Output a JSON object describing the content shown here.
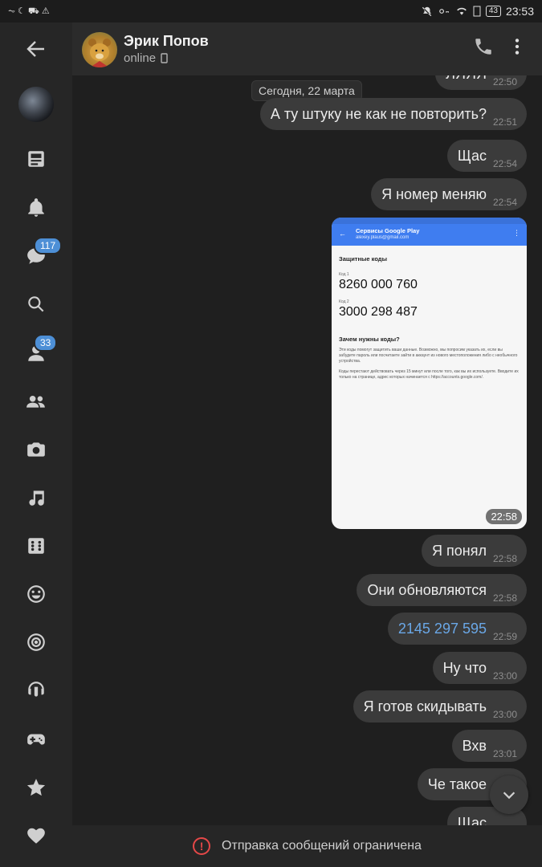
{
  "status_bar": {
    "time": "23:53",
    "battery": "43",
    "left_icons": "⏦ ☾ ⛟ ⚠"
  },
  "colors": {
    "accent": "#4d8fd6",
    "bubble": "#3b3b3b",
    "background": "#1f1f1f",
    "sidebar": "#262626",
    "header": "#2b2b2b",
    "warning": "#e54848",
    "link": "#6aa7e6"
  },
  "sidebar": {
    "items": [
      {
        "icon": "profile-avatar"
      },
      {
        "icon": "news-icon"
      },
      {
        "icon": "bell-icon"
      },
      {
        "icon": "messages-icon",
        "badge": "117"
      },
      {
        "icon": "search-icon"
      },
      {
        "icon": "friends-icon",
        "badge": "33"
      },
      {
        "icon": "groups-icon"
      },
      {
        "icon": "camera-icon"
      },
      {
        "icon": "music-icon"
      },
      {
        "icon": "games-dice-icon"
      },
      {
        "icon": "smile-icon"
      },
      {
        "icon": "target-icon"
      },
      {
        "icon": "podcast-icon"
      },
      {
        "icon": "gamepad-icon"
      },
      {
        "icon": "star-icon"
      },
      {
        "icon": "heart-icon"
      }
    ]
  },
  "header": {
    "name": "Эрик Попов",
    "status": "online"
  },
  "chat": {
    "partial_top": {
      "text": "ЛЯЯЯ",
      "time": "22:50"
    },
    "date_separator": "Сегодня, 22 марта",
    "messages": [
      {
        "text": "А ту штуку не как не повторить?",
        "time": "22:51"
      },
      {
        "text": "Щас",
        "time": "22:54"
      },
      {
        "text": "Я номер меняю",
        "time": "22:54"
      },
      {
        "text": "Я понял",
        "time": "22:58"
      },
      {
        "text": "Они обновляются",
        "time": "22:58"
      },
      {
        "text": "2145 297  595",
        "time": "22:59"
      },
      {
        "text": "Ну что",
        "time": "23:00"
      },
      {
        "text": "Я готов скидывать",
        "time": "23:00"
      },
      {
        "text": "Вхв",
        "time": "23:01"
      },
      {
        "text": "Че такое",
        "time": ""
      },
      {
        "text": "Щас",
        "time": ""
      }
    ],
    "screenshot": {
      "app_title": "Сервисы Google Play",
      "account": "alexey.plaus@gmail.com",
      "heading": "Защитные коды",
      "code1_label": "Код 1",
      "code1": "8260 000 760",
      "code2_label": "Код 2",
      "code2": "3000 298 487",
      "why_heading": "Зачем нужны коды?",
      "para1": "Эти коды помогут защитить ваши данные. Возможно, мы попросим указать их, если вы забудете пароль или посчитаете зайти в аккаунт из нового местоположения либо с необычного устройства.",
      "para2": "Коды перестают действовать через 15 минут или после того, как вы их используете. Вводите их только на странице, адрес которых начинается с https://accounts.google.com/.",
      "time": "22:58"
    }
  },
  "footer": {
    "notice": "Отправка сообщений ограничена"
  }
}
